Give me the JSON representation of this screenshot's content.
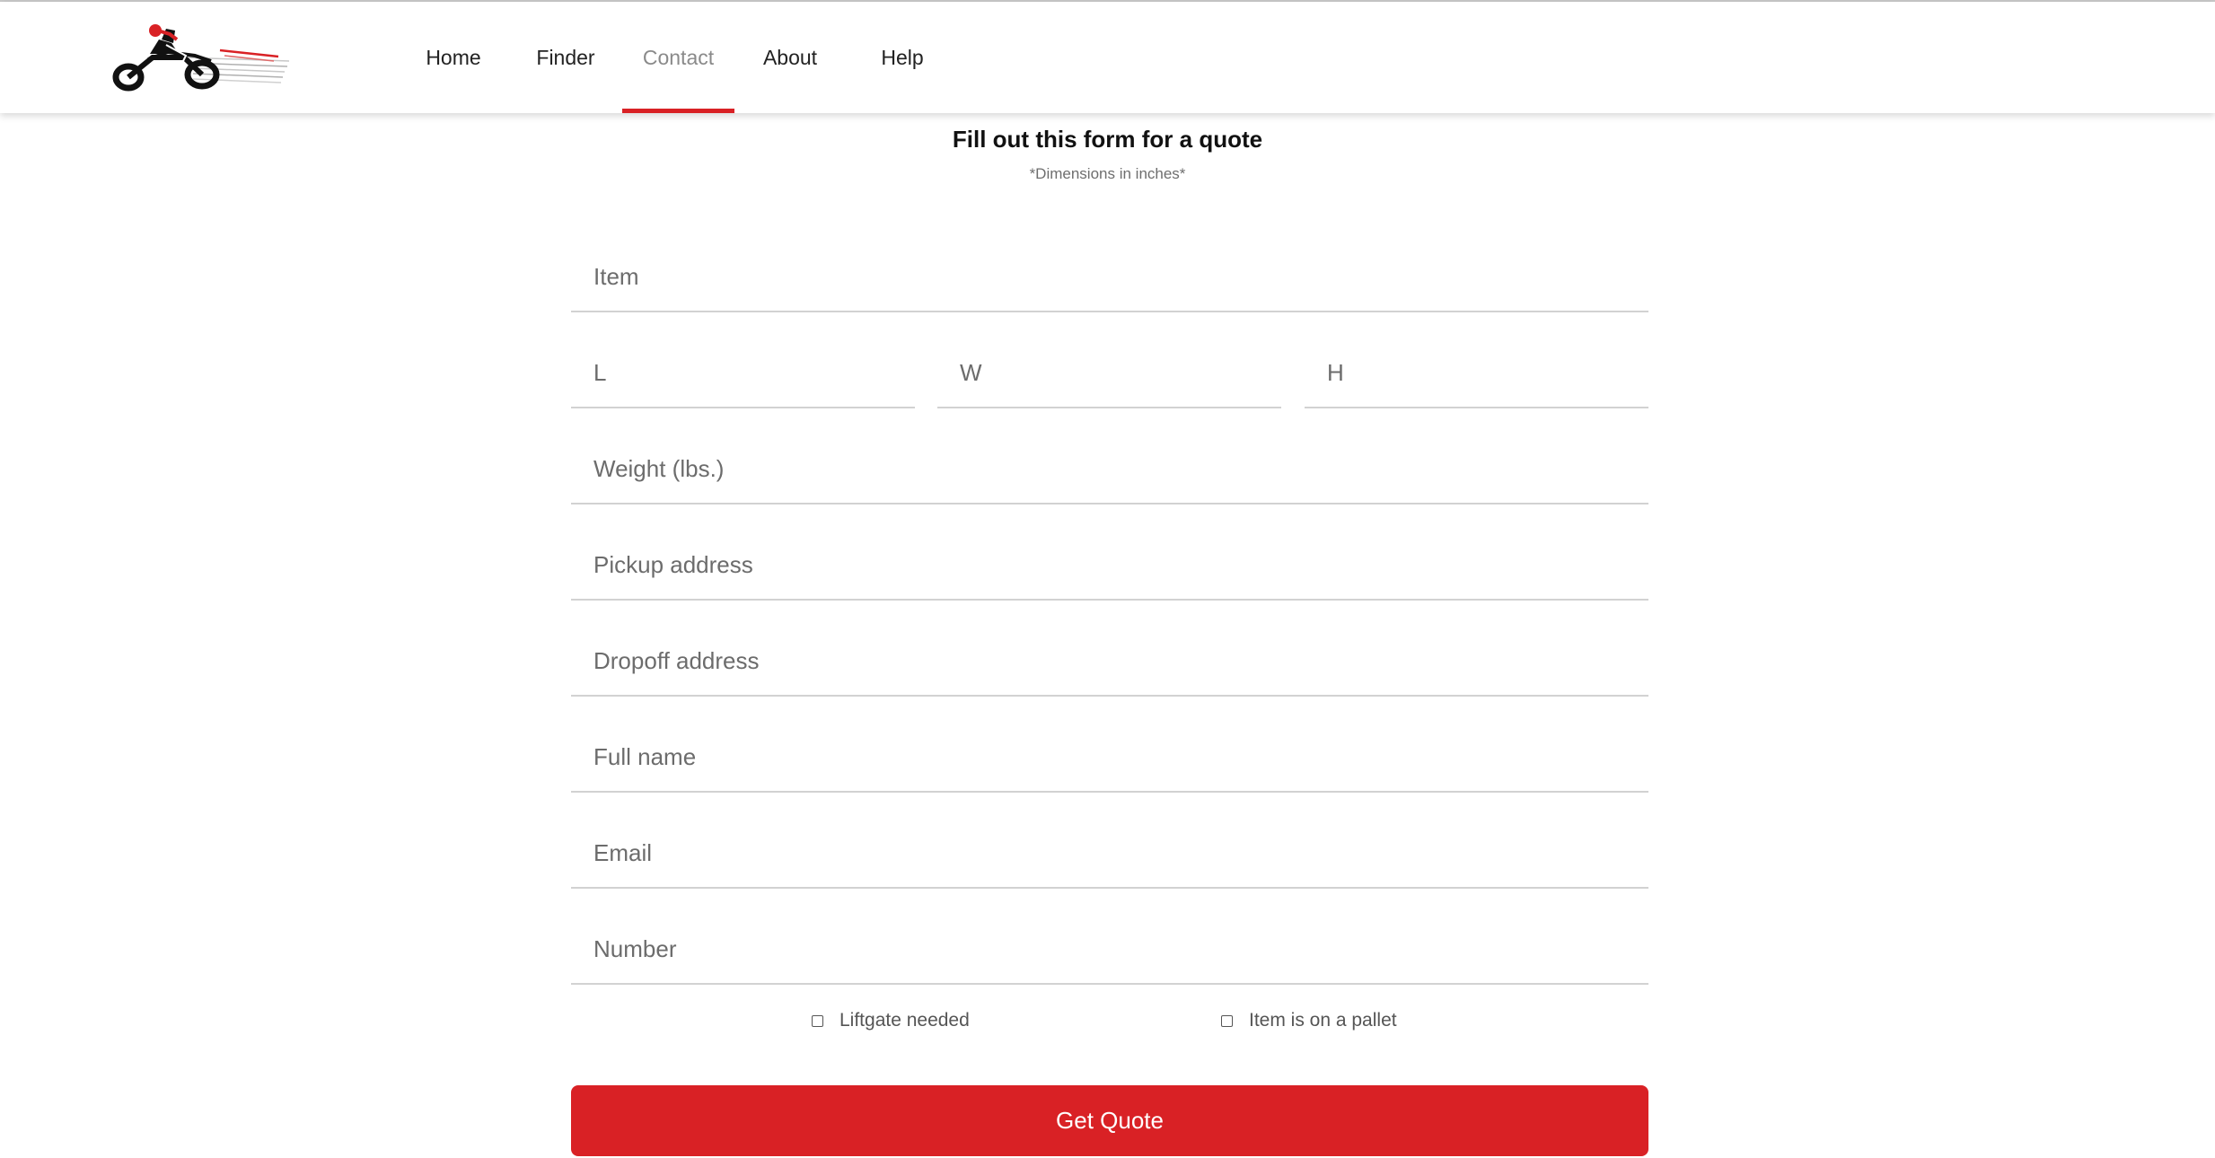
{
  "nav": {
    "items": [
      {
        "label": "Home"
      },
      {
        "label": "Finder"
      },
      {
        "label": "Contact"
      },
      {
        "label": "About"
      },
      {
        "label": "Help"
      }
    ],
    "active": "Contact"
  },
  "form": {
    "title": "Fill out this form for a quote",
    "subtitle": "*Dimensions in inches*",
    "fields": {
      "item": {
        "placeholder": "Item",
        "value": ""
      },
      "length": {
        "placeholder": "L",
        "value": ""
      },
      "width": {
        "placeholder": "W",
        "value": ""
      },
      "height": {
        "placeholder": "H",
        "value": ""
      },
      "weight": {
        "placeholder": "Weight (lbs.)",
        "value": ""
      },
      "pickup": {
        "placeholder": "Pickup address",
        "value": ""
      },
      "dropoff": {
        "placeholder": "Dropoff address",
        "value": ""
      },
      "fullname": {
        "placeholder": "Full name",
        "value": ""
      },
      "email": {
        "placeholder": "Email",
        "value": ""
      },
      "number": {
        "placeholder": "Number",
        "value": ""
      }
    },
    "checkboxes": {
      "liftgate": {
        "label": "Liftgate needed",
        "checked": false
      },
      "pallet": {
        "label": "Item is on a pallet",
        "checked": false
      }
    },
    "submit_label": "Get Quote"
  },
  "colors": {
    "accent": "#d92125",
    "divider": "#d2d2d2",
    "placeholder": "#6c6c6c"
  },
  "icons": {
    "logo": "motorcycle-rider-logo"
  }
}
